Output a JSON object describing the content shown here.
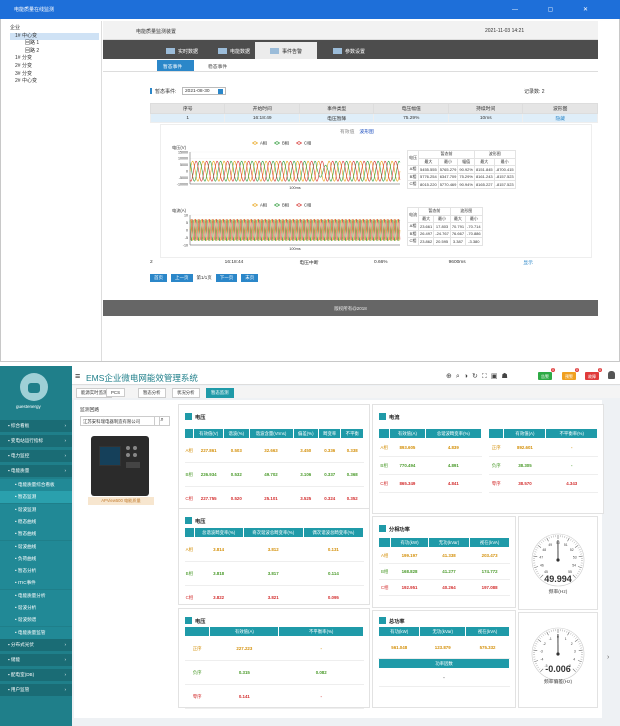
{
  "win1": {
    "title": "电能质量在线监测",
    "controls": "— ▢ ✕",
    "tree": [
      {
        "label": "企业",
        "indent": 0,
        "selected": false
      },
      {
        "label": "1# 中心变",
        "indent": 1,
        "selected": true
      },
      {
        "label": "回路 1",
        "indent": 3,
        "selected": false
      },
      {
        "label": "回路 2",
        "indent": 3,
        "selected": false
      },
      {
        "label": "1# 分变",
        "indent": 1,
        "selected": false
      },
      {
        "label": "2# 分变",
        "indent": 1,
        "selected": false
      },
      {
        "label": "3# 分变",
        "indent": 1,
        "selected": false
      },
      {
        "label": "2# 中心变",
        "indent": 1,
        "selected": false
      }
    ],
    "page_title": "电能质量监测装置",
    "datetime": "2021-11-03 14:21",
    "tabs": [
      {
        "label": "实时数据",
        "active": false
      },
      {
        "label": "电能数据",
        "active": false
      },
      {
        "label": "事件告警",
        "active": true
      },
      {
        "label": "参数设置",
        "active": false
      }
    ],
    "subtabs": [
      "暂态事件",
      "稳态事件"
    ],
    "date_label": "暂态事件:",
    "date_value": "2021-08-30",
    "record_count": "记录数: 2",
    "event_headers": [
      "序号",
      "开始时间",
      "事件类型",
      "电压幅值",
      "持续时间",
      "波形图"
    ],
    "events": [
      {
        "no": "1",
        "time": "16:18:49",
        "type": "电压暂降",
        "amp": "75.29%",
        "dur": "10ms",
        "wave": "隐藏"
      },
      {
        "no": "2",
        "time": "16:18:44",
        "type": "电压中断",
        "amp": "0.66%",
        "dur": "9600ms",
        "wave": "显示"
      }
    ],
    "wave_modes": {
      "a": "有效值",
      "b": "波形图"
    },
    "legend": [
      "A相",
      "B相",
      "C相"
    ],
    "v_chart": {
      "ylabel": "电压(V)",
      "xlabel": "100ms",
      "ticks": [
        "15000",
        "10000",
        "5000",
        "0",
        "-5000",
        "-10000"
      ]
    },
    "i_chart": {
      "ylabel": "电流(A)",
      "xlabel": "100ms",
      "ticks": [
        "10",
        "5",
        "0",
        "-5",
        "-10"
      ]
    },
    "v_table": {
      "h1": [
        "电压",
        "暂态前",
        "",
        "波形图"
      ],
      "h2": [
        "最大",
        "最小",
        "幅值",
        "最大",
        "最小"
      ],
      "rows": [
        [
          "A相",
          "5455.555",
          "5765.279",
          "90.92%",
          "8151.845",
          "-8700.415"
        ],
        [
          "B相",
          "5776.254",
          "6347.709",
          "75.29%",
          "8161.243",
          "-8157.523"
        ],
        [
          "C相",
          "8015.220",
          "5770.469",
          "90.94%",
          "8165.227",
          "-8157.523"
        ]
      ]
    },
    "i_table": {
      "h1": [
        "电流",
        "暂态前",
        "",
        "波形图"
      ],
      "h2": [
        "最大",
        "最小",
        "最大",
        "最小"
      ],
      "rows": [
        [
          "A相",
          "23.661",
          "17.803",
          "70.791",
          "-70.714"
        ],
        [
          "B相",
          "26.497",
          "-24.767",
          "76.667",
          "-70.886"
        ],
        [
          "C相",
          "23.862",
          "20.595",
          "3.387",
          "-3.380"
        ]
      ]
    },
    "pager": {
      "first": "首页",
      "prev": "上一页",
      "info": "第1/1页",
      "next": "下一页",
      "last": "末页"
    },
    "footer": "版权所有@2018"
  },
  "win2": {
    "title": "EMS企业微电网能效管理系统",
    "user": "guestenergy",
    "tags": [
      {
        "text": "告警",
        "color": "#2eaa45",
        "count": "0"
      },
      {
        "text": "预警",
        "color": "#f0a020",
        "count": "0"
      },
      {
        "text": "故障",
        "color": "#e03a3a",
        "count": "0"
      }
    ],
    "crumbs": [
      "能源实时监测",
      "PCS",
      "暂态分析",
      "状况分析",
      "暂态监测"
    ],
    "sidebar": [
      {
        "label": "综合看板",
        "kind": "grp"
      },
      {
        "label": "变电站运行指标",
        "kind": "grp"
      },
      {
        "label": "电力监控",
        "kind": "grp"
      },
      {
        "label": "电能质量",
        "kind": "grp"
      },
      {
        "label": "电能质量综合看板",
        "kind": "sub"
      },
      {
        "label": "暂态监测",
        "kind": "sub",
        "active": true
      },
      {
        "label": "谐波监测",
        "kind": "sub"
      },
      {
        "label": "稳态曲线",
        "kind": "sub"
      },
      {
        "label": "暂态曲线",
        "kind": "sub"
      },
      {
        "label": "谐波曲线",
        "kind": "sub"
      },
      {
        "label": "负荷曲线",
        "kind": "sub"
      },
      {
        "label": "暂态分析",
        "kind": "sub"
      },
      {
        "label": "ITIC事件",
        "kind": "sub"
      },
      {
        "label": "电能质量分析",
        "kind": "sub"
      },
      {
        "label": "谐波分析",
        "kind": "sub"
      },
      {
        "label": "谐波频谱",
        "kind": "sub"
      },
      {
        "label": "电能质量监管",
        "kind": "sub"
      },
      {
        "label": "分布式光伏",
        "kind": "grp"
      },
      {
        "label": "储能",
        "kind": "grp"
      },
      {
        "label": "配电室(DB)",
        "kind": "grp"
      },
      {
        "label": "用户监管",
        "kind": "grp"
      }
    ],
    "loop_label": "监测回路",
    "loop_value": "江苏安科瑞电器制造有限公司",
    "device_caption": "APView500 电能质量",
    "voltage": {
      "title": "电压",
      "headers": [
        "",
        "有效值(V)",
        "谐波(%)",
        "谐波含量(Vrms)",
        "偏差(%)",
        "畸变率",
        "不平衡"
      ],
      "rows": [
        [
          "A相",
          "227.861",
          "0.503",
          "32.663",
          "3.450",
          "0.336",
          "0.338"
        ],
        [
          "B相",
          "226.934",
          "0.532",
          "49.702",
          "3.106",
          "0.337",
          "0.368"
        ],
        [
          "C相",
          "227.755",
          "0.520",
          "25.101",
          "3.525",
          "0.324",
          "0.352"
        ]
      ]
    },
    "flicker": {
      "title": "电压",
      "headers": [
        "",
        "总谐波畸变率(%)",
        "奇次谐波总畸变率(%)",
        "偶次谐波总畸变率(%)"
      ],
      "rows": [
        [
          "A相",
          "3.814",
          "3.812",
          "0.131"
        ],
        [
          "B相",
          "3.818",
          "3.817",
          "0.114"
        ],
        [
          "C相",
          "3.822",
          "3.821",
          "0.095"
        ]
      ]
    },
    "unbal": {
      "title": "电压",
      "headers": [
        "",
        "有效值(A)",
        "不平衡率(%)"
      ],
      "rows": [
        [
          "正序",
          "227.223",
          "-"
        ],
        [
          "负序",
          "0.315",
          "0.082"
        ],
        [
          "零序",
          "0.141",
          "-"
        ]
      ]
    },
    "current": {
      "title": "电流",
      "headers1": [
        "",
        "有效值(A)",
        "总谐波畸变率(%)"
      ],
      "rows1": [
        [
          "A相",
          "893.605",
          "4.839"
        ],
        [
          "B相",
          "770.494",
          "4.891"
        ],
        [
          "C相",
          "865.349",
          "4.841"
        ]
      ],
      "headers2": [
        "",
        "有效值(A)",
        "不平衡率(%)"
      ],
      "rows2": [
        [
          "正序",
          "892.601",
          "-"
        ],
        [
          "负序",
          "38.305",
          "-"
        ],
        [
          "零序",
          "38.570",
          "4.343"
        ]
      ]
    },
    "phase_power": {
      "title": "分相功率",
      "headers": [
        "",
        "有功(kW)",
        "无功(kVar)",
        "视在(kVA)"
      ],
      "rows": [
        [
          "A相",
          "199.197",
          "41.338",
          "203.473"
        ],
        [
          "B相",
          "168.828",
          "41.277",
          "174.772"
        ],
        [
          "C相",
          "192.951",
          "40.264",
          "197.088"
        ]
      ]
    },
    "total_power": {
      "title": "总功率",
      "headers": [
        "有功(kW)",
        "无功(kVar)",
        "视在(kVA)"
      ],
      "row": [
        "561.048",
        "123.879",
        "575.332"
      ],
      "pf_label": "功率因数",
      "pf_value": "-"
    },
    "freq_gauge": {
      "value": "49.994",
      "label": "频率(Hz)",
      "min": 45,
      "max": 55,
      "reading": 49.994,
      "ticks": [
        "45",
        "46",
        "47",
        "48",
        "49",
        "50",
        "51",
        "52",
        "53",
        "54",
        "55"
      ]
    },
    "dev_gauge": {
      "value": "-0.006",
      "label": "频率偏差(Hz)",
      "min": -5,
      "max": 5,
      "reading": -0.006,
      "ticks": [
        "-5",
        "-4",
        "-3",
        "-2",
        "-1",
        "0",
        "1",
        "2",
        "3",
        "4",
        "5"
      ]
    }
  }
}
